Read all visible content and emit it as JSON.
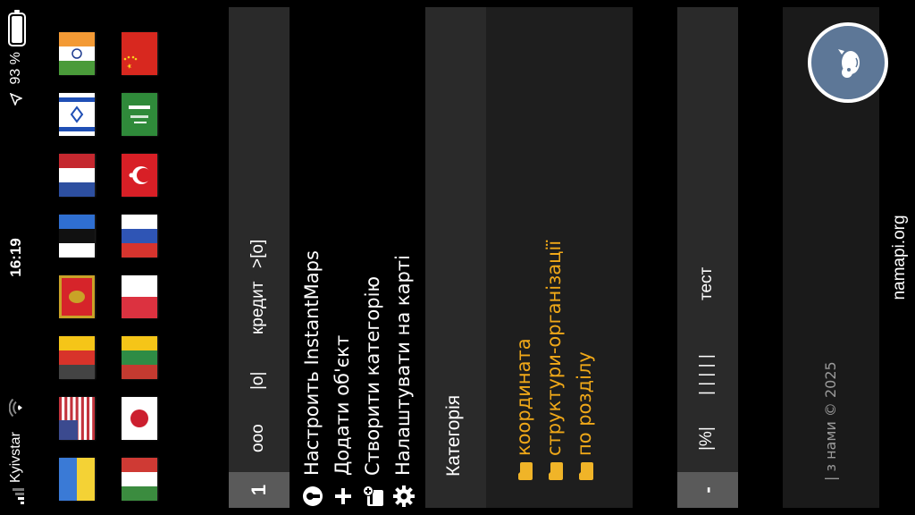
{
  "status_bar": {
    "carrier": "Kyivstar",
    "time": "16:19",
    "battery": "93 %"
  },
  "flags": [
    {
      "name": "ukraine"
    },
    {
      "name": "usa"
    },
    {
      "name": "germany"
    },
    {
      "name": "montenegro"
    },
    {
      "name": "estonia"
    },
    {
      "name": "netherlands"
    },
    {
      "name": "israel"
    },
    {
      "name": "india"
    },
    {
      "name": "hungary"
    },
    {
      "name": "japan"
    },
    {
      "name": "lithuania"
    },
    {
      "name": "poland"
    },
    {
      "name": "russia"
    },
    {
      "name": "turkey"
    },
    {
      "name": "saudi-arabia"
    },
    {
      "name": "china"
    }
  ],
  "menu": {
    "number": "1",
    "items": [
      "ooo",
      "|o|",
      "кредит",
      ">[o]"
    ]
  },
  "actions": [
    {
      "icon": "keyhole-icon",
      "label": "Настроить InstantMaps"
    },
    {
      "icon": "plus-icon",
      "label": "Додати об'єкт"
    },
    {
      "icon": "new-folder-icon",
      "label": "Створити категорію"
    },
    {
      "icon": "gear-icon",
      "label": "Налаштувати на карті"
    }
  ],
  "category": {
    "title": "Категорія",
    "items": [
      "координата",
      "структури-організації",
      "по розділу"
    ]
  },
  "toolbar2": {
    "number": "-",
    "items": [
      "|%|",
      "| | | | |",
      "тест"
    ]
  },
  "footer": {
    "text": "| з нами © 2025",
    "fab_icon": "owl-icon"
  },
  "domain": "namapi.org",
  "colors": {
    "accent_orange": "#f0a818",
    "panel": "#2a2a2a",
    "fab": "#5d7797"
  }
}
